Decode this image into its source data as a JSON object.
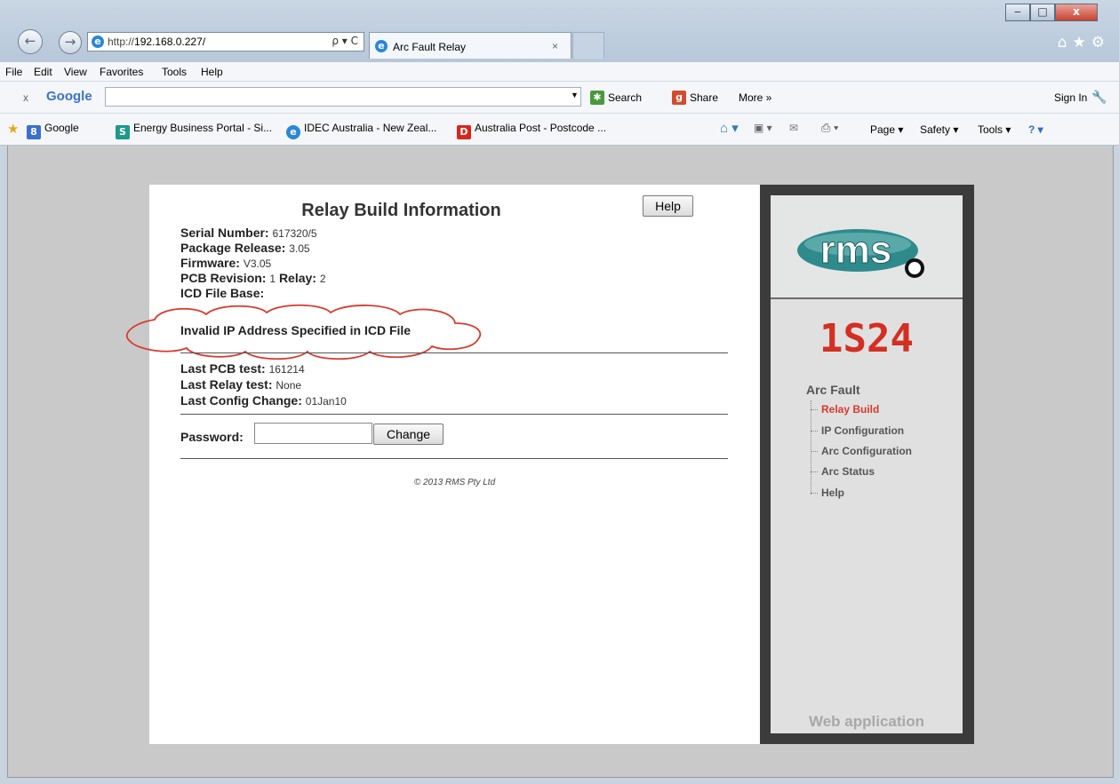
{
  "browser": {
    "url_prefix": "http://",
    "url_host": "192.168.0.227/",
    "address_tools": "ρ ▾ C",
    "tab_title": "Arc Fault Relay",
    "tab_close": "×",
    "window_controls": {
      "minimize": "‒",
      "maximize": "□",
      "close": "x"
    },
    "right_icons": "⌂★⚙",
    "menu": [
      "File",
      "Edit",
      "View",
      "Favorites",
      "Tools",
      "Help"
    ],
    "google_toolbar": {
      "close": "x",
      "brand": "Google",
      "search_value": "",
      "search_label": "Search",
      "share_label": "Share",
      "more_label": "More »",
      "sign_in": "Sign In"
    },
    "favorites": [
      {
        "label": "Google",
        "icon": "8"
      },
      {
        "label": "Energy Business Portal - Si...",
        "icon": "S"
      },
      {
        "label": "IDEC Australia - New Zeal...",
        "icon": "e"
      },
      {
        "label": "Australia Post - Postcode ...",
        "icon": "D"
      }
    ],
    "command_bar": {
      "page": "Page ▾",
      "safety": "Safety ▾",
      "tools": "Tools ▾",
      "help": "? ▾"
    }
  },
  "relay_page": {
    "title": "Relay Build Information",
    "help_button": "Help",
    "serial_label": "Serial Number:",
    "serial_value": "617320/5",
    "package_label": "Package Release:",
    "package_value": "3.05",
    "firmware_label": "Firmware:",
    "firmware_value": "V3.05",
    "pcb_label": "PCB Revision:",
    "pcb_value": "1",
    "relay_label": "Relay:",
    "relay_value": "2",
    "icd_label": "ICD File Base:",
    "icd_value": "",
    "warning": "Invalid IP Address Specified in ICD File",
    "last_pcb_label": "Last PCB test:",
    "last_pcb_value": "161214",
    "last_relay_label": "Last Relay test:",
    "last_relay_value": "None",
    "last_config_label": "Last Config Change:",
    "last_config_value": "01Jan10",
    "password_label": "Password:",
    "password_value": "",
    "change_button": "Change",
    "copyright": "© 2013 RMS Pty Ltd"
  },
  "sidebar": {
    "logo_text": "rms",
    "model": "1S24",
    "section": "Arc Fault",
    "links": [
      "Relay Build",
      "IP Configuration",
      "Arc Configuration",
      "Arc Status",
      "Help"
    ],
    "footer": "Web application"
  },
  "colors": {
    "accent": "#d32f22",
    "sidebar_frame": "#3b3b3b",
    "logo_teal": "#2f8a8c"
  }
}
